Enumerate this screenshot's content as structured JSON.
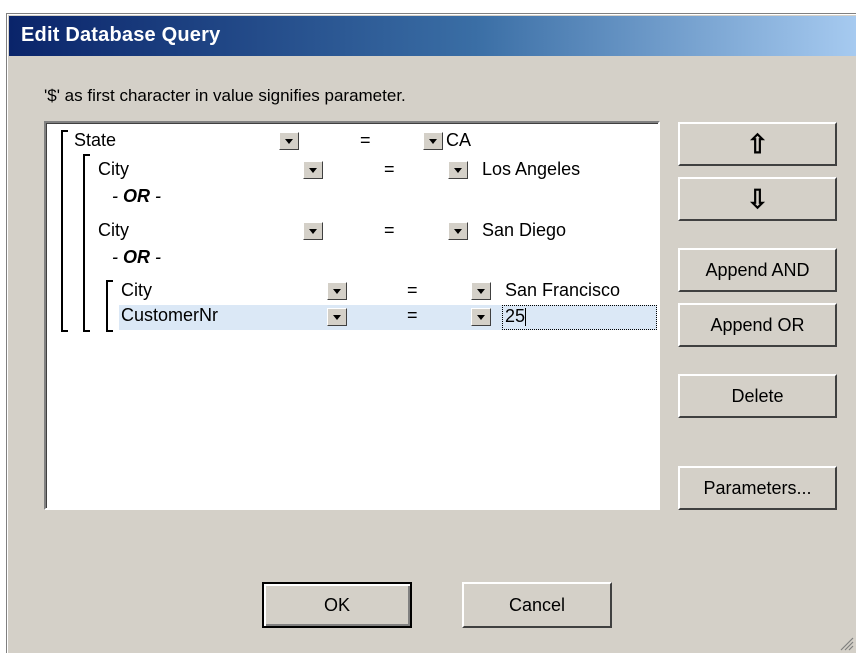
{
  "dialog": {
    "title": "Edit Database Query",
    "hint": "'$' as first character in value signifies parameter."
  },
  "query": {
    "rows": [
      {
        "field": "State",
        "op": "=",
        "value": "CA"
      },
      {
        "field": "City",
        "op": "=",
        "value": "Los Angeles"
      },
      {
        "field": "City",
        "op": "=",
        "value": "San Diego"
      },
      {
        "field": "City",
        "op": "=",
        "value": "San Francisco"
      },
      {
        "field": "CustomerNr",
        "op": "=",
        "value": "25"
      }
    ],
    "or_label_dash_left": "- ",
    "or_label": "OR",
    "or_label_dash_right": " -"
  },
  "buttons": {
    "move_up_icon": "⇧",
    "move_down_icon": "⇩",
    "append_and": "Append AND",
    "append_or": "Append OR",
    "delete": "Delete",
    "parameters": "Parameters...",
    "ok": "OK",
    "cancel": "Cancel"
  },
  "colors": {
    "title_start": "#0a246a",
    "title_end": "#a6caf0",
    "dialog_bg": "#d4d0c8",
    "selected_row": "#dbe8f6"
  }
}
